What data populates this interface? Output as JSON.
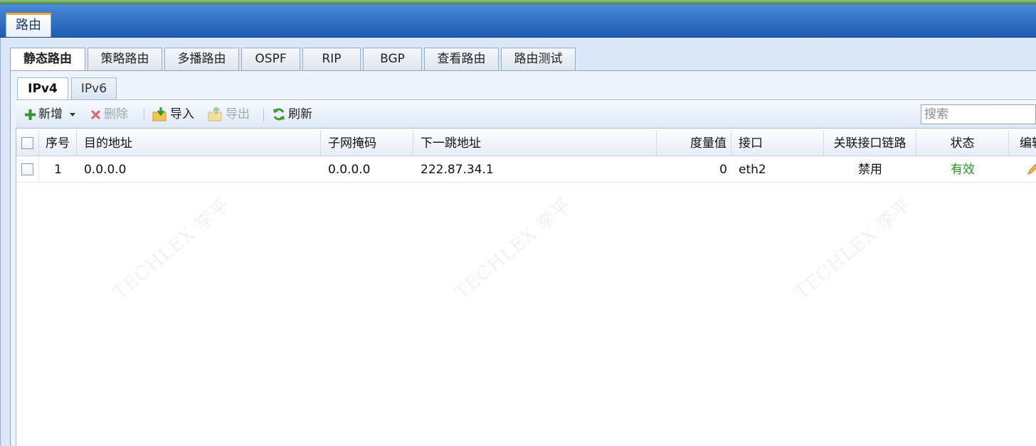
{
  "window": {
    "tab_label": "路由"
  },
  "tabs_level1": [
    {
      "label": "静态路由",
      "active": true
    },
    {
      "label": "策略路由"
    },
    {
      "label": "多播路由"
    },
    {
      "label": "OSPF"
    },
    {
      "label": "RIP"
    },
    {
      "label": "BGP"
    },
    {
      "label": "查看路由"
    },
    {
      "label": "路由测试"
    }
  ],
  "tabs_level2": [
    {
      "label": "IPv4",
      "active": true
    },
    {
      "label": "IPv6"
    }
  ],
  "toolbar": {
    "add": "新增",
    "delete": "删除",
    "import": "导入",
    "export": "导出",
    "refresh": "刷新",
    "search_placeholder": "搜索"
  },
  "table": {
    "columns": [
      "序号",
      "目的地址",
      "子网掩码",
      "下一跳地址",
      "度量值",
      "接口",
      "关联接口链路",
      "状态",
      "编辑"
    ],
    "rows": [
      {
        "index": "1",
        "destination": "0.0.0.0",
        "netmask": "0.0.0.0",
        "next_hop": "222.87.34.1",
        "metric": "0",
        "interface": "eth2",
        "linked_interface": "禁用",
        "status": "有效"
      }
    ]
  },
  "watermark": {
    "text": "TECHLEX 李平"
  },
  "colors": {
    "header_blue": "#2f6fc4",
    "accent_orange": "#f3a93a",
    "status_green": "#1f9a1f"
  }
}
